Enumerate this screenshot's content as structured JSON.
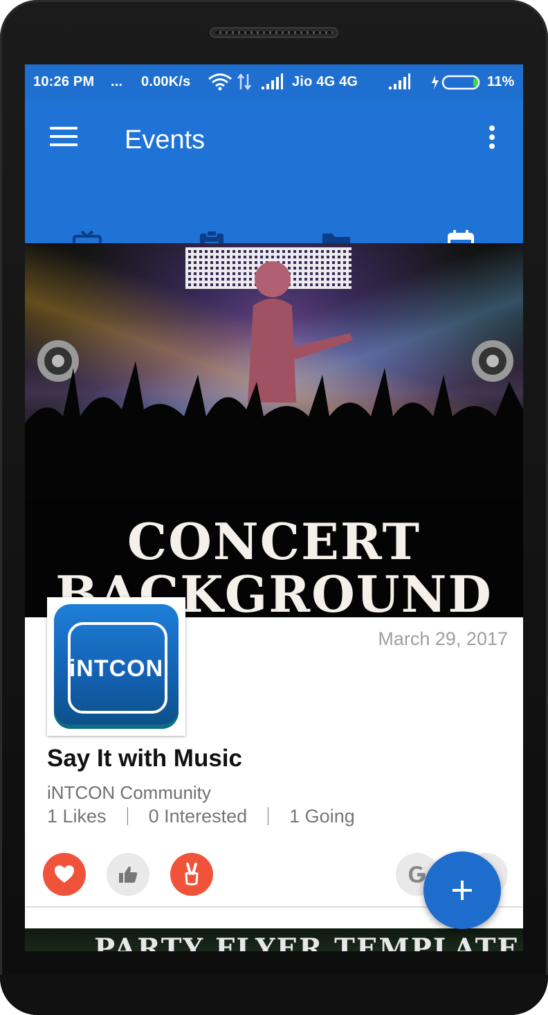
{
  "status_bar": {
    "time": "10:26 PM",
    "dots": "...",
    "speed": "0.00K/s",
    "carrier": "Jio 4G 4G",
    "battery": "11%"
  },
  "toolbar": {
    "title": "Events",
    "menu_icon": "hamburger-menu-icon",
    "more_icon": "more-vertical-icon"
  },
  "tabs": [
    {
      "icon": "gift-card-icon"
    },
    {
      "icon": "clipboard-icon"
    },
    {
      "icon": "folder-icon"
    },
    {
      "icon": "calendar-star-icon",
      "selected": true
    }
  ],
  "event": {
    "cover_line1": "CONCERT",
    "cover_line2": "BACKGROUND",
    "logo_text": "iNTCON",
    "date": "March 29, 2017",
    "title": "Say It with Music",
    "organizer": "iNTCON Community",
    "likes": "1 Likes",
    "interested": "0 Interested",
    "going": "1 Going"
  },
  "actions": {
    "love_color": "#f0533a",
    "like_color": "#e9e9e9",
    "peace_color": "#f0533a"
  },
  "next_event": {
    "cover_text": "PARTY FLYER TEMPLATE"
  },
  "fab": {
    "icon": "plus-icon",
    "color": "#1e6ccc"
  }
}
